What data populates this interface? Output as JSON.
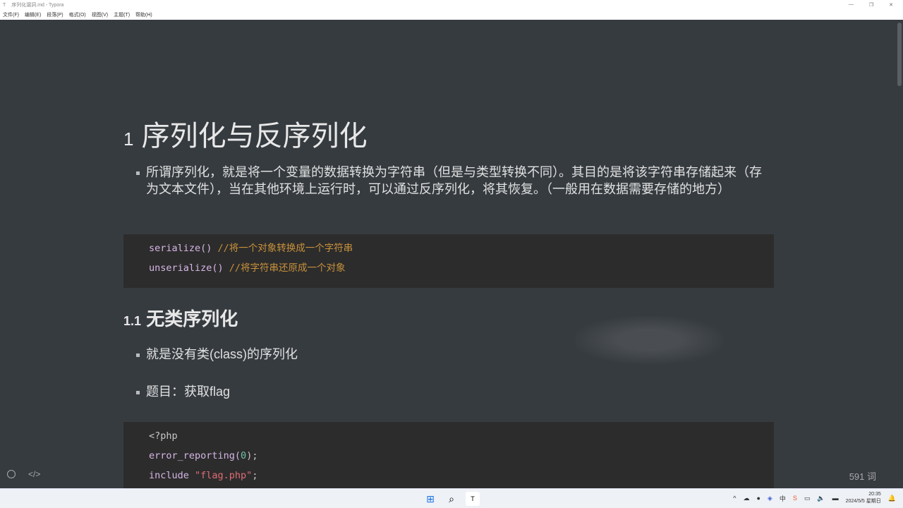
{
  "window": {
    "title": "序列化漏洞.md - Typora",
    "app_icon": "T"
  },
  "menu": [
    "文件(F)",
    "编辑(E)",
    "段落(P)",
    "格式(O)",
    "视图(V)",
    "主题(T)",
    "帮助(H)"
  ],
  "doc": {
    "h1": {
      "num": "1",
      "text": "序列化与反序列化"
    },
    "intro": "所谓序列化，就是将一个变量的数据转换为字符串（但是与类型转换不同）。其目的是将该字符串存储起来（存为文本文件），当在其他环境上运行时，可以通过反序列化，将其恢复。（一般用在数据需要存储的地方）",
    "code1": [
      {
        "fn": "serialize()",
        "comment": " //将一个对象转换成一个字符串"
      },
      {
        "fn": "unserialize()",
        "comment": " //将字符串还原成一个对象"
      }
    ],
    "h2": {
      "num": "1.1",
      "text": "无类序列化"
    },
    "bullet1": "就是没有类(class)的序列化",
    "bullet2": "题目：获取flag",
    "code2": {
      "line1": "<?php",
      "line2_fn": "error_reporting(",
      "line2_num": "0",
      "line2_end": ");",
      "line3_kw": "include ",
      "line3_str": "\"flag.php\"",
      "line3_end": ";"
    }
  },
  "watermark": "极客时代",
  "status": {
    "word_count": "591 词"
  },
  "taskbar": {
    "time": "20:35",
    "date": "2024/5/5 星期日"
  }
}
